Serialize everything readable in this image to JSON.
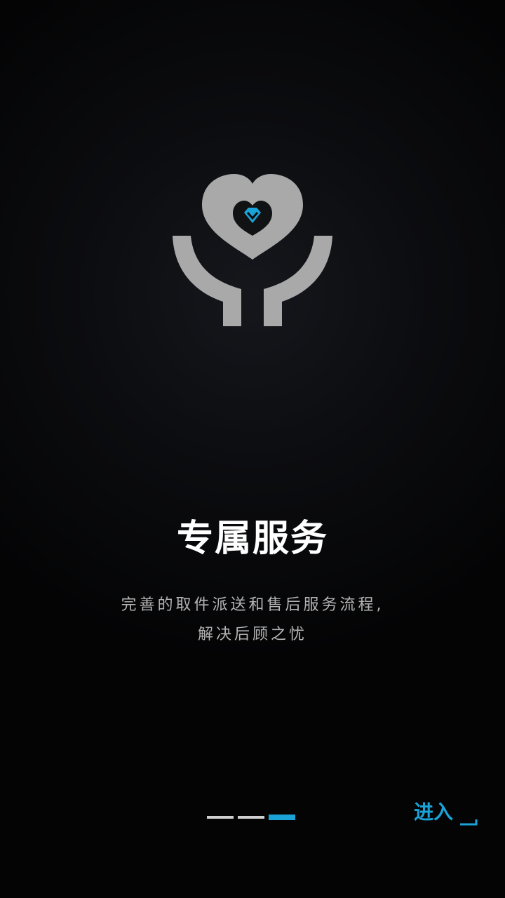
{
  "app": {
    "accent_color": "#1aa3d6",
    "logo_icon": "heart-with-hands-diamond-icon"
  },
  "slide": {
    "title": "专属服务",
    "description_lines": [
      "完善的取件派送和售后服务流程,",
      "解决后顾之忧"
    ]
  },
  "pager": {
    "total": 3,
    "current": 3
  },
  "enter_button": {
    "label": "进入",
    "icon": "arrow-corner-icon"
  }
}
